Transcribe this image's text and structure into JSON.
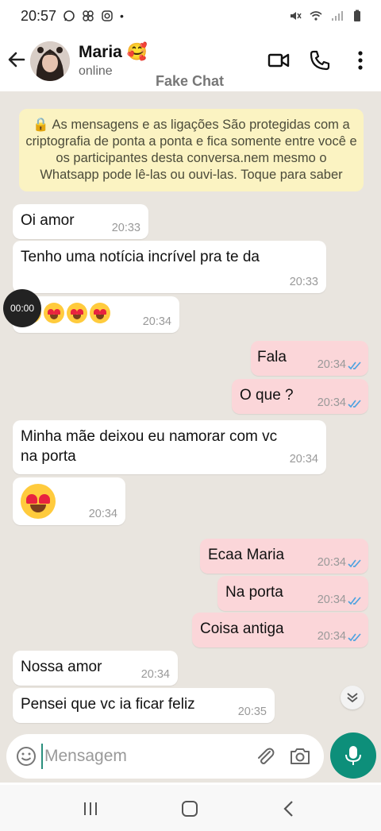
{
  "status_bar": {
    "time": "20:57",
    "dot": "•"
  },
  "header": {
    "contact_name": "Maria 🥰",
    "contact_status": "online",
    "watermark": "Fake Chat"
  },
  "notice": {
    "text": "🔒 As mensagens e as ligações São protegidas com a criptografia de ponta a ponta e fica somente entre você e os participantes desta conversa.nem mesmo o Whatsapp pode lê-las ou ouvi-las. Toque para saber"
  },
  "recording_timer": "00:00",
  "messages": [
    {
      "direction": "in",
      "text": "Oi amor",
      "time": "20:33"
    },
    {
      "direction": "in",
      "text": "Tenho uma notícia incrível pra te da",
      "time": "20:33"
    },
    {
      "direction": "in",
      "text": "😍😍😍😍",
      "time": "20:34"
    },
    {
      "direction": "out",
      "text": "Fala",
      "time": "20:34"
    },
    {
      "direction": "out",
      "text": "O que ?",
      "time": "20:34"
    },
    {
      "direction": "in",
      "text": "Minha mãe deixou eu namorar com vc na porta",
      "time": "20:34"
    },
    {
      "direction": "in",
      "text": "😍",
      "time": "20:34"
    },
    {
      "direction": "out",
      "text": "Ecaa Maria",
      "time": "20:34"
    },
    {
      "direction": "out",
      "text": "Na porta",
      "time": "20:34"
    },
    {
      "direction": "out",
      "text": "Coisa antiga",
      "time": "20:34"
    },
    {
      "direction": "in",
      "text": "Nossa amor",
      "time": "20:34"
    },
    {
      "direction": "in",
      "text": "Pensei que vc ia ficar feliz",
      "time": "20:35"
    }
  ],
  "composer": {
    "placeholder": "Mensagem"
  },
  "colors": {
    "accent": "#0d8f7a",
    "outgoing_bubble": "#fbd6d9",
    "incoming_bubble": "#ffffff",
    "chat_bg": "#e9e5df",
    "notice_bg": "#fbf3c2",
    "read_ticks": "#4fa3e0"
  }
}
